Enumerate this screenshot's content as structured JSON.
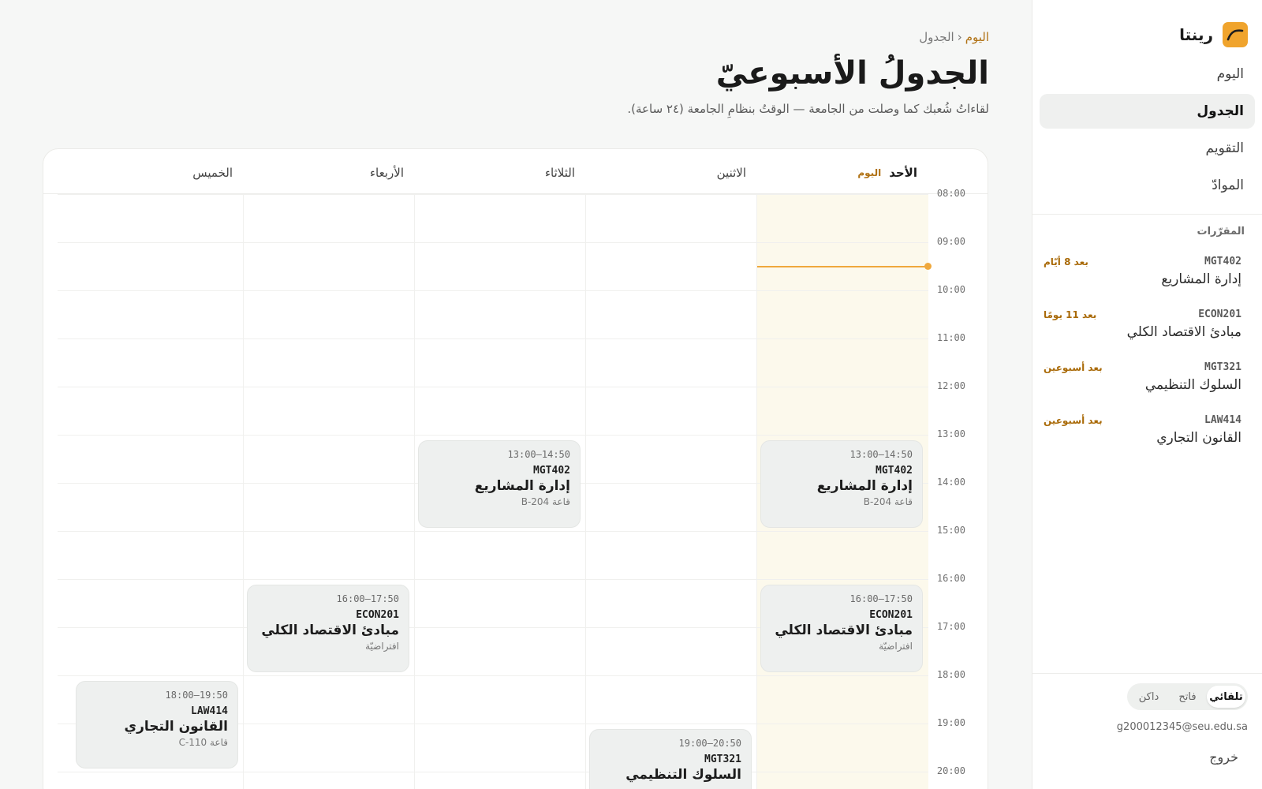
{
  "brand": {
    "name": "رينتا"
  },
  "nav": [
    {
      "label": "اليوم"
    },
    {
      "label": "الجدول"
    },
    {
      "label": "التقويم"
    },
    {
      "label": "الموادّ"
    }
  ],
  "courses_label": "المقرّرات",
  "courses": [
    {
      "code": "MGT402",
      "title": "إدارة المشاريع",
      "due": "بعد 8 أيّام"
    },
    {
      "code": "ECON201",
      "title": "مبادئ الاقتصاد الكلي",
      "due": "بعد 11 يومًا"
    },
    {
      "code": "MGT321",
      "title": "السلوك التنظيمي",
      "due": "بعد أسبوعين"
    },
    {
      "code": "LAW414",
      "title": "القانون التجاري",
      "due": "بعد أسبوعين"
    }
  ],
  "theme": {
    "options": [
      "تلقائي",
      "فاتح",
      "داكن"
    ],
    "selected": "تلقائي"
  },
  "user": {
    "email": "g200012345@seu.edu.sa",
    "logout": "خروج"
  },
  "breadcrumb": {
    "home": "اليوم",
    "separator": "‹",
    "current": "الجدول"
  },
  "page": {
    "title": "الجدولُ الأسبوعيّ",
    "subtitle": "لقاءاتُ شُعبك كما وصلت من الجامعة — الوقتُ بنظامِ الجامعة (٢٤ ساعة)."
  },
  "today_label": "اليوم",
  "days": [
    "الأحد",
    "الاثنين",
    "الثلاثاء",
    "الأربعاء",
    "الخميس"
  ],
  "today_index": 0,
  "hours": [
    "08:00",
    "09:00",
    "10:00",
    "11:00",
    "12:00",
    "13:00",
    "14:00",
    "15:00",
    "16:00",
    "17:00",
    "18:00",
    "19:00",
    "20:00"
  ],
  "now_time": "09:30",
  "events": [
    {
      "day": 0,
      "start": "13:00",
      "time": "13:00–14:50",
      "code": "MGT402",
      "title": "إدارة المشاريع",
      "location": "قاعة B-204"
    },
    {
      "day": 2,
      "start": "13:00",
      "time": "13:00–14:50",
      "code": "MGT402",
      "title": "إدارة المشاريع",
      "location": "قاعة B-204"
    },
    {
      "day": 0,
      "start": "16:00",
      "time": "16:00–17:50",
      "code": "ECON201",
      "title": "مبادئ الاقتصاد الكلي",
      "location": "افتراضيّة"
    },
    {
      "day": 3,
      "start": "16:00",
      "time": "16:00–17:50",
      "code": "ECON201",
      "title": "مبادئ الاقتصاد الكلي",
      "location": "افتراضيّة"
    },
    {
      "day": 4,
      "start": "18:00",
      "time": "18:00–19:50",
      "code": "LAW414",
      "title": "القانون التجاري",
      "location": "قاعة C-110"
    },
    {
      "day": 1,
      "start": "19:00",
      "time": "19:00–20:50",
      "code": "MGT321",
      "title": "السلوك التنظيمي",
      "location": ""
    }
  ]
}
